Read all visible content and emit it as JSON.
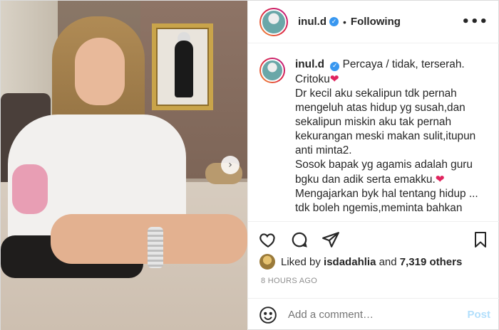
{
  "header": {
    "username": "inul.d",
    "separator": "•",
    "follow_status": "Following",
    "more": "•••"
  },
  "caption": {
    "username": "inul.d",
    "lines": [
      "Percaya / tidak, terserah.",
      "Critoku",
      "Dr kecil aku sekalipun tdk pernah",
      "mengeluh atas hidup yg susah,dan",
      "sekalipun miskin aku tak pernah",
      "kekurangan meski makan sulit,itupun",
      "anti minta2.",
      "Sosok bapak yg agamis adalah guru",
      "bgku dan adik serta emakku.",
      "Mengajarkan byk hal tentang hidup ...",
      "tdk boleh ngemis,meminta bahkan"
    ],
    "emoji": "❤"
  },
  "likes": {
    "prefix": "Liked by",
    "user": "isdadahlia",
    "connector": "and",
    "others": "7,319 others"
  },
  "timestamp": "8 HOURS AGO",
  "comment": {
    "placeholder": "Add a comment…",
    "post_label": "Post"
  },
  "icons": {
    "like": "heart-icon",
    "comment": "comment-icon",
    "share": "share-icon",
    "save": "bookmark-icon",
    "emoji": "emoji-icon",
    "next": "chevron-right-icon",
    "verified": "verified-badge-icon"
  },
  "colors": {
    "verified": "#3897f0",
    "post_disabled": "#b2dffc",
    "muted": "#8e8e8e",
    "text": "#262626"
  }
}
